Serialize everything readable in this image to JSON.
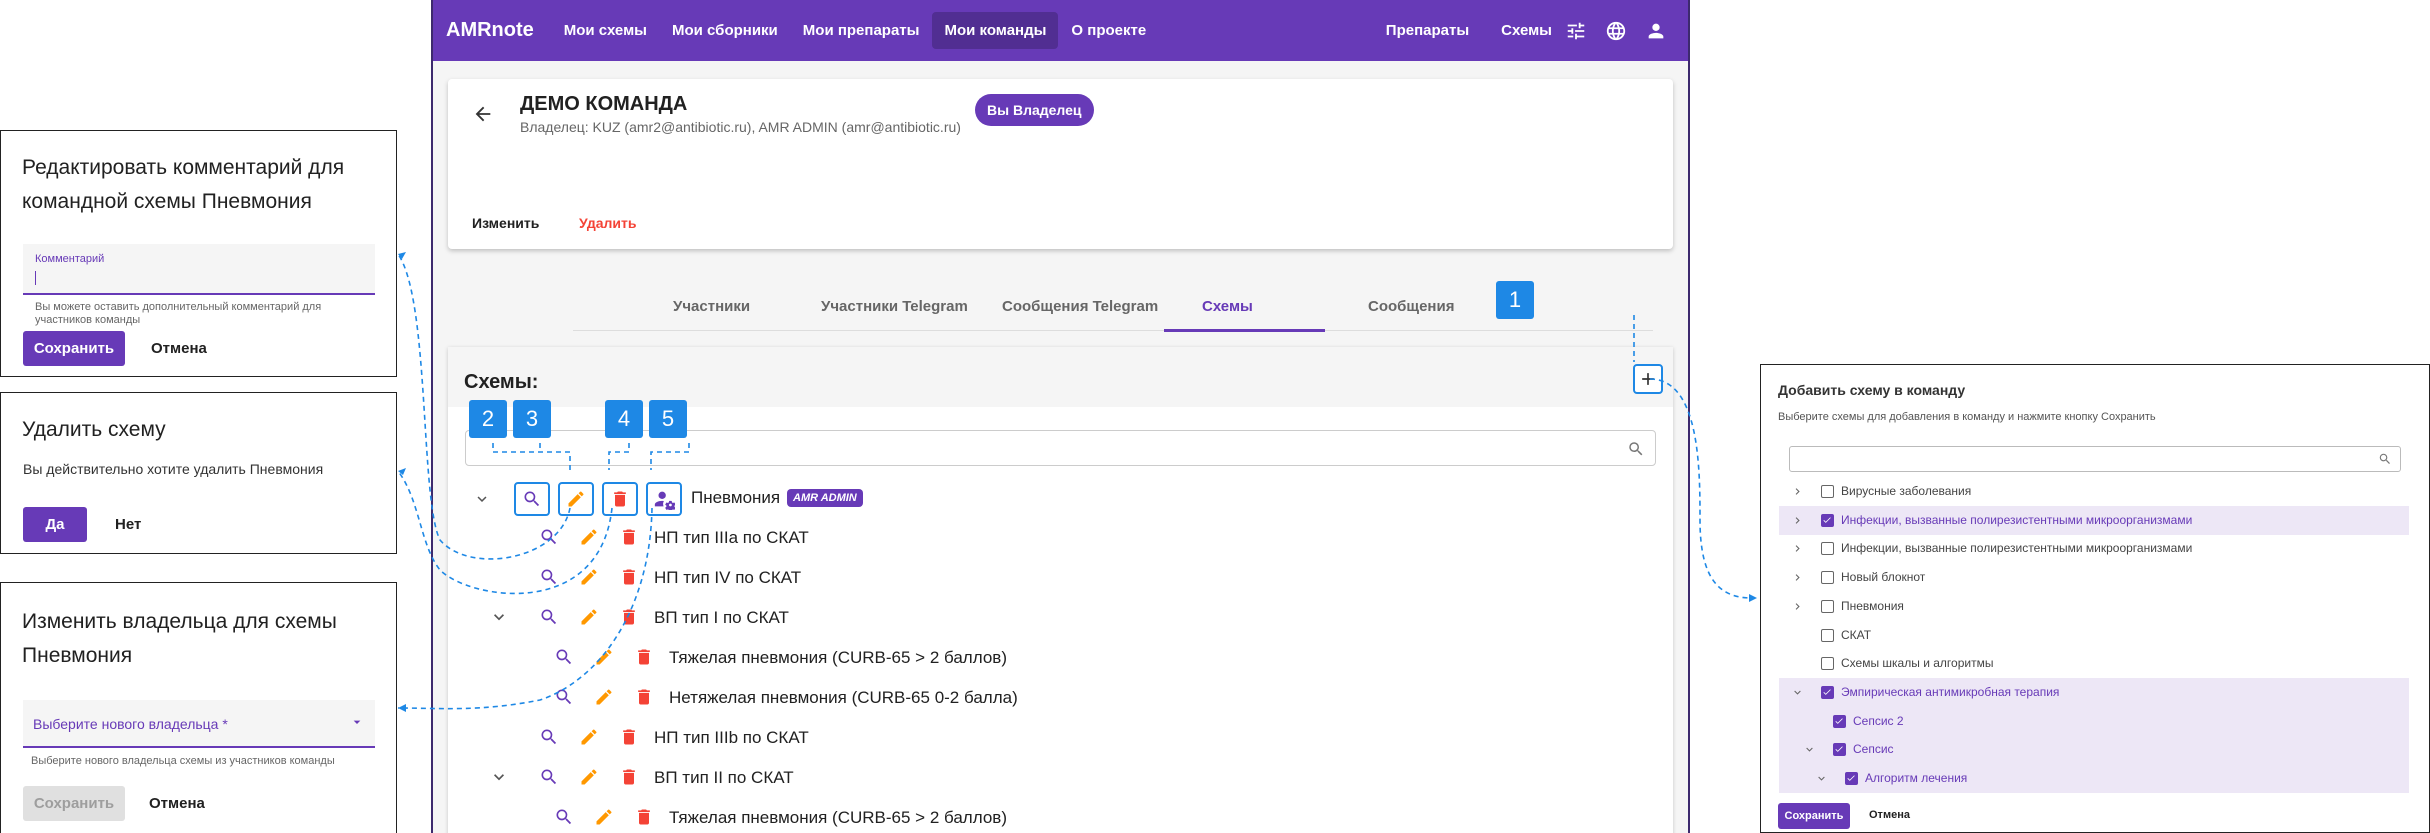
{
  "app": {
    "brand": "AMRnote",
    "nav": [
      "Мои схемы",
      "Мои сборники",
      "Мои препараты",
      "Мои команды",
      "О проекте"
    ],
    "nav_right": [
      "Препараты",
      "Схемы"
    ]
  },
  "team": {
    "title": "ДЕМО КОМАНДА",
    "owner_line": "Владелец: KUZ (amr2@antibiotic.ru), AMR ADMIN (amr@antibiotic.ru)",
    "badge": "Вы Владелец",
    "edit": "Изменить",
    "delete": "Удалить"
  },
  "tabs": [
    "Участники",
    "Участники Telegram",
    "Сообщения Telegram",
    "Схемы",
    "Сообщения"
  ],
  "schemes": {
    "title": "Схемы:",
    "root_label": "Пневмония",
    "root_badge": "AMR ADMIN",
    "rows": [
      "НП тип IIIa по СКАТ",
      "НП тип IV по СКАТ",
      "ВП тип I по СКАТ",
      "Тяжелая пневмония (CURB-65 > 2 баллов)",
      "Нетяжелая пневмония (CURB-65 0-2 балла)",
      "НП тип IIIb по СКАТ",
      "ВП тип II по СКАТ",
      "Тяжелая пневмония (CURB-65 > 2 баллов)"
    ]
  },
  "callouts": [
    "1",
    "2",
    "3",
    "4",
    "5"
  ],
  "dialog_comment": {
    "title": "Редактировать комментарий для командной схемы Пневмония",
    "field_label": "Комментарий",
    "hint": "Вы можете оставить дополнительный комментарий для участников команды",
    "save": "Сохранить",
    "cancel": "Отмена"
  },
  "dialog_delete": {
    "title": "Удалить схему",
    "text": "Вы действительно хотите удалить Пневмония",
    "yes": "Да",
    "no": "Нет"
  },
  "dialog_owner": {
    "title": "Изменить владельца для схемы Пневмония",
    "select_label": "Выберите нового владельца *",
    "hint": "Выберите нового владельца схемы из участников команды",
    "save": "Сохранить",
    "cancel": "Отмена"
  },
  "dialog_add": {
    "title": "Добавить схему в команду",
    "subtitle": "Выберите схемы для добавления в команду и нажмите кнопку Сохранить",
    "items": [
      {
        "label": "Вирусные заболевания",
        "checked": false
      },
      {
        "label": "Инфекции, вызванные полирезистентными микроорганизмами",
        "checked": true
      },
      {
        "label": "Инфекции, вызванные полирезистентными микроорганизмами",
        "checked": false
      },
      {
        "label": "Новый блокнот",
        "checked": false
      },
      {
        "label": "Пневмония",
        "checked": false
      },
      {
        "label": "СКАТ",
        "checked": false
      },
      {
        "label": "Схемы шкалы и алгоритмы",
        "checked": false
      },
      {
        "label": "Эмпирическая антимикробная терапия",
        "checked": true
      },
      {
        "label": "Сепсис 2",
        "checked": true
      },
      {
        "label": "Сепсис",
        "checked": true
      },
      {
        "label": "Алгоритм лечения",
        "checked": true
      }
    ],
    "save": "Сохранить",
    "cancel": "Отмена"
  },
  "colors": {
    "primary": "#673ab7",
    "accent": "#1e88e5",
    "danger": "#f44336",
    "edit": "#ff9800"
  }
}
